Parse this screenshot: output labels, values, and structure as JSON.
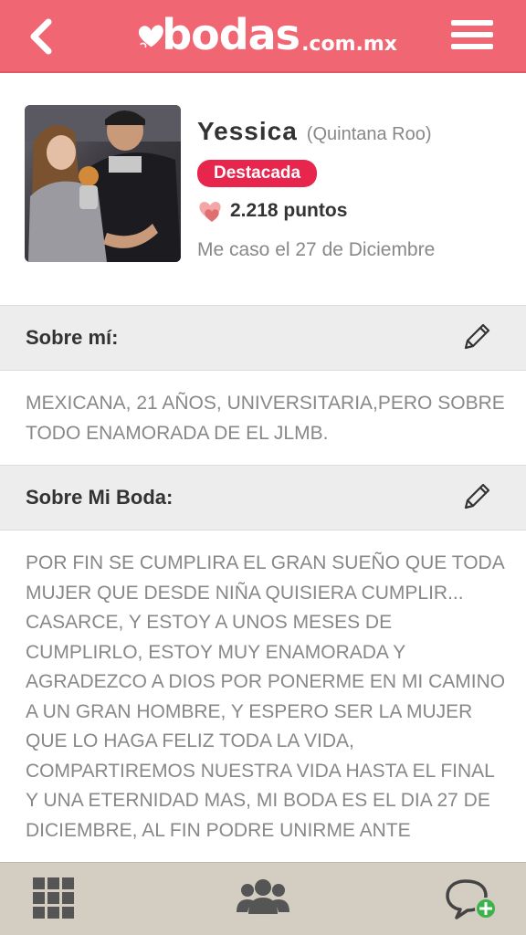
{
  "header": {
    "logo_text": "bodas",
    "logo_suffix": ".com.mx",
    "brand_color": "#f06773"
  },
  "profile": {
    "name": "Yessica",
    "location": "(Quintana Roo)",
    "badge": "Destacada",
    "badge_color": "#e8264d",
    "points": "2.218 puntos",
    "wedding_date": "Me caso el 27 de Diciembre"
  },
  "about_me": {
    "title": "Sobre mí:",
    "text": "MEXICANA, 21 AÑOS, UNIVERSITARIA,PERO SOBRE TODO ENAMORADA DE EL JLMB."
  },
  "about_wedding": {
    "title": "Sobre Mi Boda:",
    "text": "POR FIN SE CUMPLIRA EL GRAN SUEÑO QUE TODA MUJER QUE DESDE NIÑA QUISIERA CUMPLIR... CASARCE, Y ESTOY A UNOS MESES DE CUMPLIRLO, ESTOY MUY ENAMORADA Y AGRADEZCO A DIOS POR PONERME EN MI CAMINO A UN GRAN HOMBRE, Y ESPERO SER LA MUJER QUE LO HAGA FELIZ TODA LA VIDA, COMPARTIREMOS NUESTRA VIDA HASTA EL FINAL Y UNA ETERNIDAD MAS, MI BODA ES EL DIA 27 DE DICIEMBRE, AL FIN PODRE UNIRME ANTE"
  },
  "bottom_nav": {
    "tabs": [
      {
        "icon": "grid-icon"
      },
      {
        "icon": "community-icon"
      },
      {
        "icon": "new-chat-icon"
      }
    ]
  }
}
